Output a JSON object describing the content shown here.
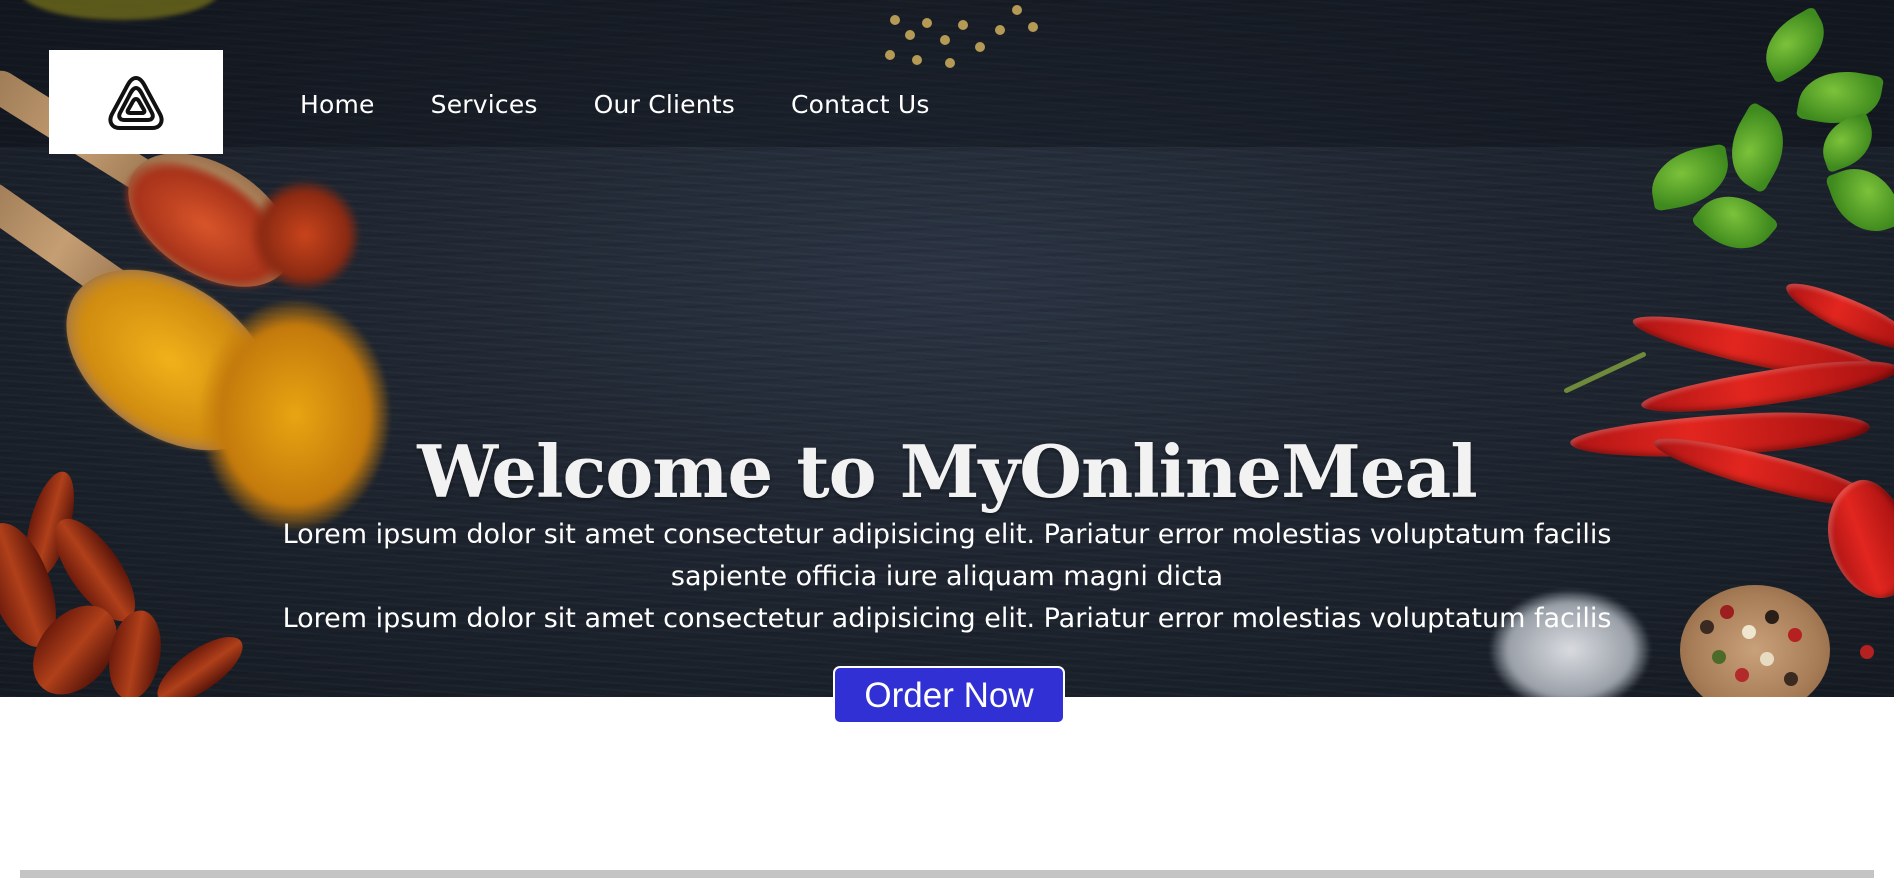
{
  "nav": {
    "logo_icon": "triangle-loop-logo-icon",
    "items": [
      {
        "label": "Home"
      },
      {
        "label": "Services"
      },
      {
        "label": "Our Clients"
      },
      {
        "label": "Contact Us"
      }
    ]
  },
  "hero": {
    "title": "Welcome to MyOnlineMeal",
    "paragraph_1": "Lorem ipsum dolor sit amet consectetur adipisicing elit. Pariatur error molestias voluptatum facilis sapiente officia iure aliquam magni dicta",
    "paragraph_2": "Lorem ipsum dolor sit amet consectetur adipisicing elit. Pariatur error molestias voluptatum facilis",
    "cta_label": "Order Now"
  },
  "colors": {
    "button_bg": "#3030d4",
    "hero_bg": "#1f2631",
    "text": "#ffffff"
  }
}
